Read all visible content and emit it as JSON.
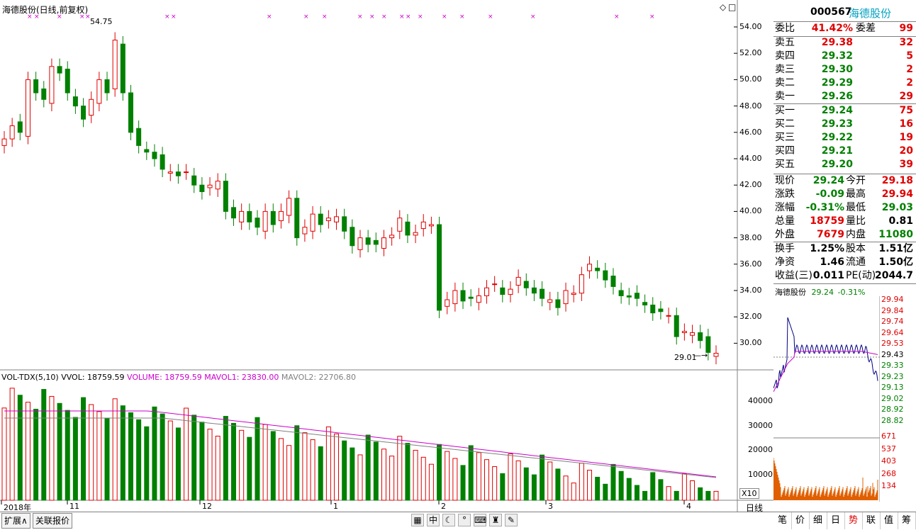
{
  "chart": {
    "title": "海德股份(日线,前复权)",
    "high_mark": "54.75",
    "low_mark": "29.01",
    "price_axis": [
      "54.00",
      "52.00",
      "50.00",
      "48.00",
      "46.00",
      "44.00",
      "42.00",
      "40.00",
      "38.00",
      "36.00",
      "34.00",
      "32.00",
      "30.00"
    ],
    "date_axis": [
      "2018年",
      "11",
      "12",
      "1",
      "2",
      "3",
      "4"
    ],
    "right_tab": "日线"
  },
  "volume": {
    "indicator": "VOL-TDX(5,10)",
    "vvol": "VVOL: 18759.59",
    "volume": "VOLUME: 18759.59",
    "mavol1": "MAVOL1: 23830.00",
    "mavol2": "MAVOL2: 22706.80",
    "axis": [
      "40000",
      "30000",
      "20000",
      "10000"
    ],
    "unit": "X10"
  },
  "stock": {
    "code": "000567",
    "name": "海德股份"
  },
  "orderbook": {
    "weibi_label": "委比",
    "weibi": "41.42%",
    "weicha_label": "委差",
    "weicha": "99",
    "sells": [
      {
        "label": "卖五",
        "price": "29.38",
        "vol": "32"
      },
      {
        "label": "卖四",
        "price": "29.32",
        "vol": "5"
      },
      {
        "label": "卖三",
        "price": "29.30",
        "vol": "2"
      },
      {
        "label": "卖二",
        "price": "29.29",
        "vol": "2"
      },
      {
        "label": "卖一",
        "price": "29.26",
        "vol": "29"
      }
    ],
    "buys": [
      {
        "label": "买一",
        "price": "29.24",
        "vol": "75"
      },
      {
        "label": "买二",
        "price": "29.23",
        "vol": "16"
      },
      {
        "label": "买三",
        "price": "29.22",
        "vol": "19"
      },
      {
        "label": "买四",
        "price": "29.21",
        "vol": "20"
      },
      {
        "label": "买五",
        "price": "29.20",
        "vol": "39"
      }
    ]
  },
  "quote": [
    {
      "l1": "现价",
      "v1": "29.24",
      "l2": "今开",
      "v2": "29.18",
      "c1": "grn",
      "c2": "red"
    },
    {
      "l1": "涨跌",
      "v1": "-0.09",
      "l2": "最高",
      "v2": "29.94",
      "c1": "grn",
      "c2": "red"
    },
    {
      "l1": "涨幅",
      "v1": "-0.31%",
      "l2": "最低",
      "v2": "29.03",
      "c1": "grn",
      "c2": "grn"
    },
    {
      "l1": "总量",
      "v1": "18759",
      "l2": "量比",
      "v2": "0.81",
      "c1": "red",
      "c2": "blk"
    },
    {
      "l1": "外盘",
      "v1": "7679",
      "l2": "内盘",
      "v2": "11080",
      "c1": "red",
      "c2": "grn"
    }
  ],
  "fundamentals": [
    {
      "l1": "换手",
      "v1": "1.25%",
      "l2": "股本",
      "v2": "1.51亿"
    },
    {
      "l1": "净资",
      "v1": "1.46",
      "l2": "流通",
      "v2": "1.50亿"
    },
    {
      "l1": "收益(三)",
      "v1": "0.011",
      "l2": "PE(动)",
      "v2": "2044.7"
    }
  ],
  "intraday": {
    "title": "海德股份",
    "price": "29.24",
    "change": "-0.31%",
    "price_axis": [
      "29.94",
      "29.84",
      "29.74",
      "29.64",
      "29.53",
      "29.43",
      "29.33",
      "29.23",
      "29.13",
      "29.02",
      "28.92",
      "28.82"
    ],
    "vol_axis": [
      "671",
      "537",
      "403",
      "268",
      "134"
    ]
  },
  "bottom": {
    "btn1": "扩展∧",
    "btn2": "关联报价"
  },
  "tabs": [
    "笔",
    "价",
    "细",
    "日",
    "势",
    "联",
    "值",
    "筹"
  ],
  "colors": {
    "up": "#e00000",
    "down": "#008000",
    "ma1": "#cc00cc",
    "ma2": "#808080"
  }
}
